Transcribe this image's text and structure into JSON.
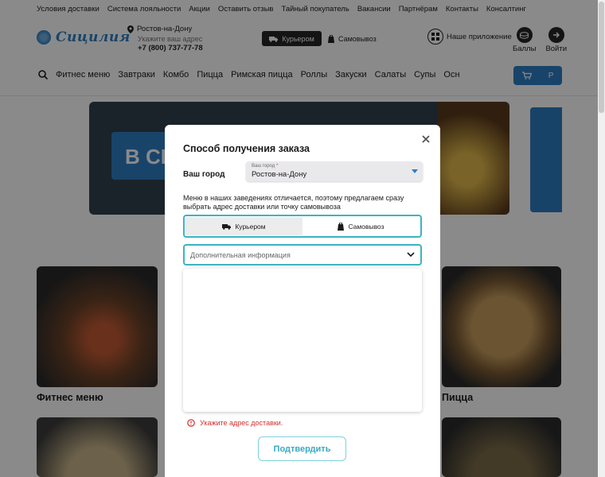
{
  "topnav": [
    "Условия доставки",
    "Система лояльности",
    "Акции",
    "Оставить отзыв",
    "Тайный покупатель",
    "Вакансии",
    "Партнёрам",
    "Контакты",
    "Консалтинг"
  ],
  "header": {
    "logo_text": "Сицилия",
    "city": "Ростов-на-Дону",
    "address_hint": "Укажите ваш адрес",
    "phone": "+7 (800) 737-77-78",
    "courier_label": "Курьером",
    "pickup_label": "Самовывоз",
    "app_label": "Наше приложение",
    "points_label": "Баллы",
    "login_label": "Войти"
  },
  "catnav": [
    "Фитнес меню",
    "Завтраки",
    "Комбо",
    "Пицца",
    "Римская пицца",
    "Роллы",
    "Закуски",
    "Салаты",
    "Супы",
    "Осн"
  ],
  "cart": {
    "currency": "Р"
  },
  "banner": {
    "text": "В СИ"
  },
  "cards": {
    "left_title": "Фитнес меню",
    "right_title": "Пицца"
  },
  "modal": {
    "title": "Способ получения заказа",
    "city_label": "Ваш город",
    "city_field_label": "Ваш город",
    "city_field_required": "*",
    "city_value": "Ростов-на-Дону",
    "info_text": "Меню в наших заведениях отличается, поэтому предлагаем сразу выбрать адрес доставки или точку самовывоза",
    "courier_option": "Курьером",
    "pickup_option": "Самовывоз",
    "address_placeholder": "Дополнительная информация",
    "error_text": "Укажите адрес доставки.",
    "confirm_label": "Подтвердить"
  },
  "colors": {
    "accent": "#3bb3c3",
    "brand": "#2e7fc4",
    "error": "#d42f2f"
  }
}
